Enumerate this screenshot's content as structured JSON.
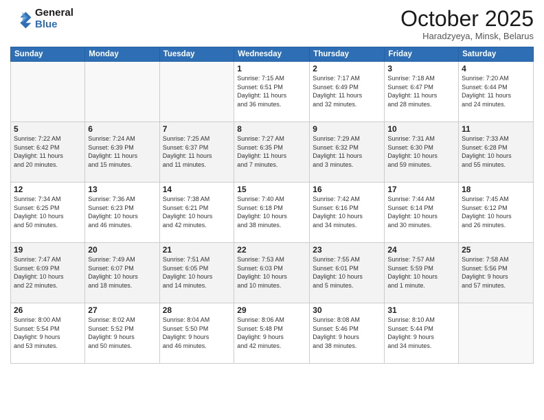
{
  "logo": {
    "line1": "General",
    "line2": "Blue"
  },
  "title": "October 2025",
  "subtitle": "Haradzyeya, Minsk, Belarus",
  "weekdays": [
    "Sunday",
    "Monday",
    "Tuesday",
    "Wednesday",
    "Thursday",
    "Friday",
    "Saturday"
  ],
  "weeks": [
    [
      {
        "day": "",
        "info": ""
      },
      {
        "day": "",
        "info": ""
      },
      {
        "day": "",
        "info": ""
      },
      {
        "day": "1",
        "info": "Sunrise: 7:15 AM\nSunset: 6:51 PM\nDaylight: 11 hours\nand 36 minutes."
      },
      {
        "day": "2",
        "info": "Sunrise: 7:17 AM\nSunset: 6:49 PM\nDaylight: 11 hours\nand 32 minutes."
      },
      {
        "day": "3",
        "info": "Sunrise: 7:18 AM\nSunset: 6:47 PM\nDaylight: 11 hours\nand 28 minutes."
      },
      {
        "day": "4",
        "info": "Sunrise: 7:20 AM\nSunset: 6:44 PM\nDaylight: 11 hours\nand 24 minutes."
      }
    ],
    [
      {
        "day": "5",
        "info": "Sunrise: 7:22 AM\nSunset: 6:42 PM\nDaylight: 11 hours\nand 20 minutes."
      },
      {
        "day": "6",
        "info": "Sunrise: 7:24 AM\nSunset: 6:39 PM\nDaylight: 11 hours\nand 15 minutes."
      },
      {
        "day": "7",
        "info": "Sunrise: 7:25 AM\nSunset: 6:37 PM\nDaylight: 11 hours\nand 11 minutes."
      },
      {
        "day": "8",
        "info": "Sunrise: 7:27 AM\nSunset: 6:35 PM\nDaylight: 11 hours\nand 7 minutes."
      },
      {
        "day": "9",
        "info": "Sunrise: 7:29 AM\nSunset: 6:32 PM\nDaylight: 11 hours\nand 3 minutes."
      },
      {
        "day": "10",
        "info": "Sunrise: 7:31 AM\nSunset: 6:30 PM\nDaylight: 10 hours\nand 59 minutes."
      },
      {
        "day": "11",
        "info": "Sunrise: 7:33 AM\nSunset: 6:28 PM\nDaylight: 10 hours\nand 55 minutes."
      }
    ],
    [
      {
        "day": "12",
        "info": "Sunrise: 7:34 AM\nSunset: 6:25 PM\nDaylight: 10 hours\nand 50 minutes."
      },
      {
        "day": "13",
        "info": "Sunrise: 7:36 AM\nSunset: 6:23 PM\nDaylight: 10 hours\nand 46 minutes."
      },
      {
        "day": "14",
        "info": "Sunrise: 7:38 AM\nSunset: 6:21 PM\nDaylight: 10 hours\nand 42 minutes."
      },
      {
        "day": "15",
        "info": "Sunrise: 7:40 AM\nSunset: 6:18 PM\nDaylight: 10 hours\nand 38 minutes."
      },
      {
        "day": "16",
        "info": "Sunrise: 7:42 AM\nSunset: 6:16 PM\nDaylight: 10 hours\nand 34 minutes."
      },
      {
        "day": "17",
        "info": "Sunrise: 7:44 AM\nSunset: 6:14 PM\nDaylight: 10 hours\nand 30 minutes."
      },
      {
        "day": "18",
        "info": "Sunrise: 7:45 AM\nSunset: 6:12 PM\nDaylight: 10 hours\nand 26 minutes."
      }
    ],
    [
      {
        "day": "19",
        "info": "Sunrise: 7:47 AM\nSunset: 6:09 PM\nDaylight: 10 hours\nand 22 minutes."
      },
      {
        "day": "20",
        "info": "Sunrise: 7:49 AM\nSunset: 6:07 PM\nDaylight: 10 hours\nand 18 minutes."
      },
      {
        "day": "21",
        "info": "Sunrise: 7:51 AM\nSunset: 6:05 PM\nDaylight: 10 hours\nand 14 minutes."
      },
      {
        "day": "22",
        "info": "Sunrise: 7:53 AM\nSunset: 6:03 PM\nDaylight: 10 hours\nand 10 minutes."
      },
      {
        "day": "23",
        "info": "Sunrise: 7:55 AM\nSunset: 6:01 PM\nDaylight: 10 hours\nand 5 minutes."
      },
      {
        "day": "24",
        "info": "Sunrise: 7:57 AM\nSunset: 5:59 PM\nDaylight: 10 hours\nand 1 minute."
      },
      {
        "day": "25",
        "info": "Sunrise: 7:58 AM\nSunset: 5:56 PM\nDaylight: 9 hours\nand 57 minutes."
      }
    ],
    [
      {
        "day": "26",
        "info": "Sunrise: 8:00 AM\nSunset: 5:54 PM\nDaylight: 9 hours\nand 53 minutes."
      },
      {
        "day": "27",
        "info": "Sunrise: 8:02 AM\nSunset: 5:52 PM\nDaylight: 9 hours\nand 50 minutes."
      },
      {
        "day": "28",
        "info": "Sunrise: 8:04 AM\nSunset: 5:50 PM\nDaylight: 9 hours\nand 46 minutes."
      },
      {
        "day": "29",
        "info": "Sunrise: 8:06 AM\nSunset: 5:48 PM\nDaylight: 9 hours\nand 42 minutes."
      },
      {
        "day": "30",
        "info": "Sunrise: 8:08 AM\nSunset: 5:46 PM\nDaylight: 9 hours\nand 38 minutes."
      },
      {
        "day": "31",
        "info": "Sunrise: 8:10 AM\nSunset: 5:44 PM\nDaylight: 9 hours\nand 34 minutes."
      },
      {
        "day": "",
        "info": ""
      }
    ]
  ]
}
